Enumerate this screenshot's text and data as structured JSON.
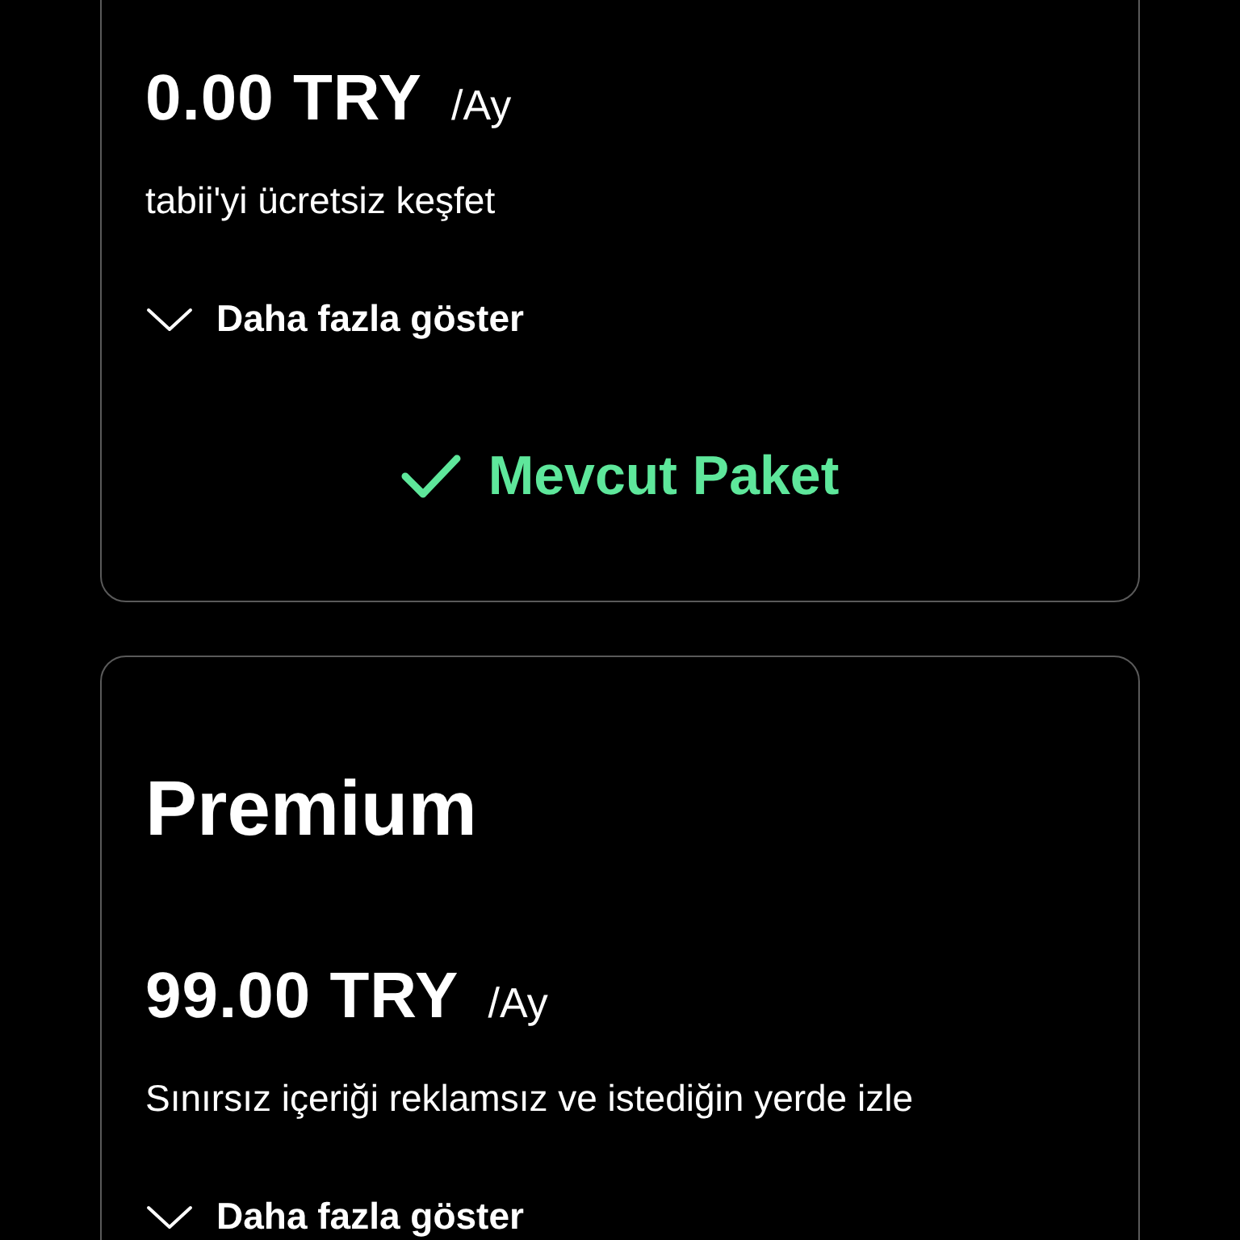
{
  "plans": [
    {
      "price": "0.00 TRY",
      "period": "/Ay",
      "description": "tabii'yi ücretsiz keşfet",
      "more_label": "Daha fazla göster",
      "current_label": "Mevcut Paket"
    },
    {
      "title": "Premium",
      "price": "99.00 TRY",
      "period": "/Ay",
      "description": "Sınırsız içeriği reklamsız ve istediğin yerde izle",
      "more_label": "Daha fazla göster"
    }
  ]
}
